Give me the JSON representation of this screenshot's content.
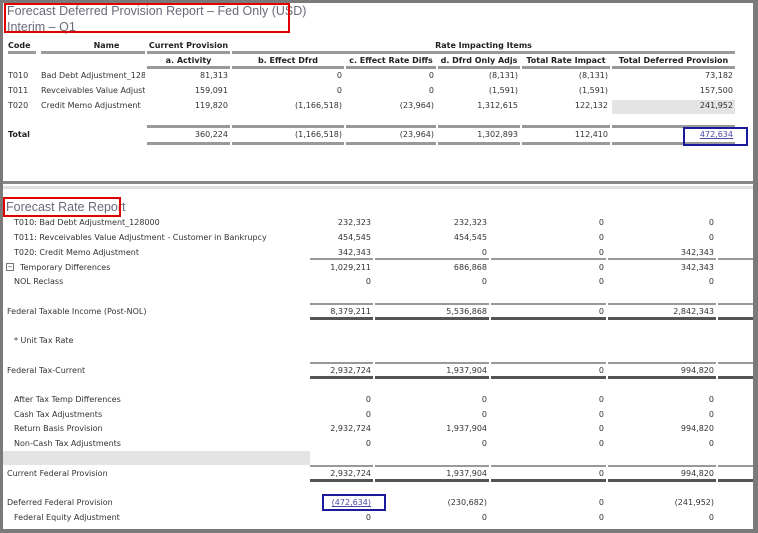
{
  "provision_report": {
    "title_line1": "Forecast Deferred Provision  Report – Fed Only (USD)",
    "title_line2": "Interim – Q1",
    "headers": {
      "code": "Code",
      "name": "Name",
      "current_provision": "Current Provision",
      "rate_impacting_items": "Rate Impacting Items",
      "a_activity": "a. Activity",
      "b_effect_dfrd": "b. Effect Dfrd",
      "c_effect_rate_diffs": "c. Effect Rate Diffs",
      "d_dfrd_only_adjs": "d. Dfrd Only Adjs",
      "total_rate_impact": "Total Rate Impact",
      "total_deferred_provision": "Total Deferred Provision"
    },
    "rows": [
      {
        "code": "T010",
        "name": "Bad Debt Adjustment_128",
        "values": [
          "81,313",
          "0",
          "0",
          "(8,131)",
          "(8,131)",
          "73,182"
        ]
      },
      {
        "code": "T011",
        "name": "Revceivables Value Adjustr",
        "values": [
          "159,091",
          "0",
          "0",
          "(1,591)",
          "(1,591)",
          "157,500"
        ]
      },
      {
        "code": "T020",
        "name": "Credit Memo Adjustment",
        "values": [
          "119,820",
          "(1,166,518)",
          "(23,964)",
          "1,312,615",
          "122,132",
          "241,952"
        ]
      }
    ],
    "total": {
      "label": "Total",
      "values": [
        "360,224",
        "(1,166,518)",
        "(23,964)",
        "1,302,893",
        "112,410",
        "472,634"
      ]
    }
  },
  "rate_report": {
    "title": "Forecast Rate Report",
    "rows": [
      {
        "label": "T010: Bad Debt Adjustment_128000",
        "values": [
          "232,323",
          "232,323",
          "0",
          "0"
        ]
      },
      {
        "label": "T011: Revceivables Value Adjustment - Customer in Bankrupcy",
        "values": [
          "454,545",
          "454,545",
          "0",
          "0"
        ]
      },
      {
        "label": "T020: Credit Memo Adjustment",
        "values": [
          "342,343",
          "0",
          "0",
          "342,343"
        ]
      },
      {
        "label": "Temporary Differences",
        "values": [
          "1,029,211",
          "686,868",
          "0",
          "342,343"
        ],
        "collapse_icon": "minus-square-icon"
      },
      {
        "label": "NOL Reclass",
        "values": [
          "0",
          "0",
          "0",
          "0"
        ]
      },
      {
        "label": "Federal Taxable Income (Post-NOL)",
        "values": [
          "8,379,211",
          "5,536,868",
          "0",
          "2,842,343"
        ]
      },
      {
        "label": "* Unit Tax Rate",
        "values": []
      },
      {
        "label": "Federal Tax-Current",
        "values": [
          "2,932,724",
          "1,937,904",
          "0",
          "994,820"
        ]
      },
      {
        "label": "After Tax Temp Differences",
        "values": [
          "0",
          "0",
          "0",
          "0"
        ]
      },
      {
        "label": "Cash Tax Adjustments",
        "values": [
          "0",
          "0",
          "0",
          "0"
        ]
      },
      {
        "label": "Return Basis Provision",
        "values": [
          "2,932,724",
          "1,937,904",
          "0",
          "994,820"
        ]
      },
      {
        "label": "Non-Cash Tax Adjustments",
        "values": [
          "0",
          "0",
          "0",
          "0"
        ]
      },
      {
        "label": "Current Federal Provision",
        "values": [
          "2,932,724",
          "1,937,904",
          "0",
          "994,820"
        ]
      },
      {
        "label": "Deferred Federal Provision",
        "values": [
          "(472,634)",
          "(230,682)",
          "0",
          "(241,952)"
        ]
      },
      {
        "label": "Federal Equity Adjustment",
        "values": [
          "0",
          "0",
          "0",
          "0"
        ]
      }
    ]
  },
  "colors": {
    "highlight_red": "#e00000",
    "highlight_blue": "#1a1a9a",
    "link": "#4a4aa8"
  }
}
